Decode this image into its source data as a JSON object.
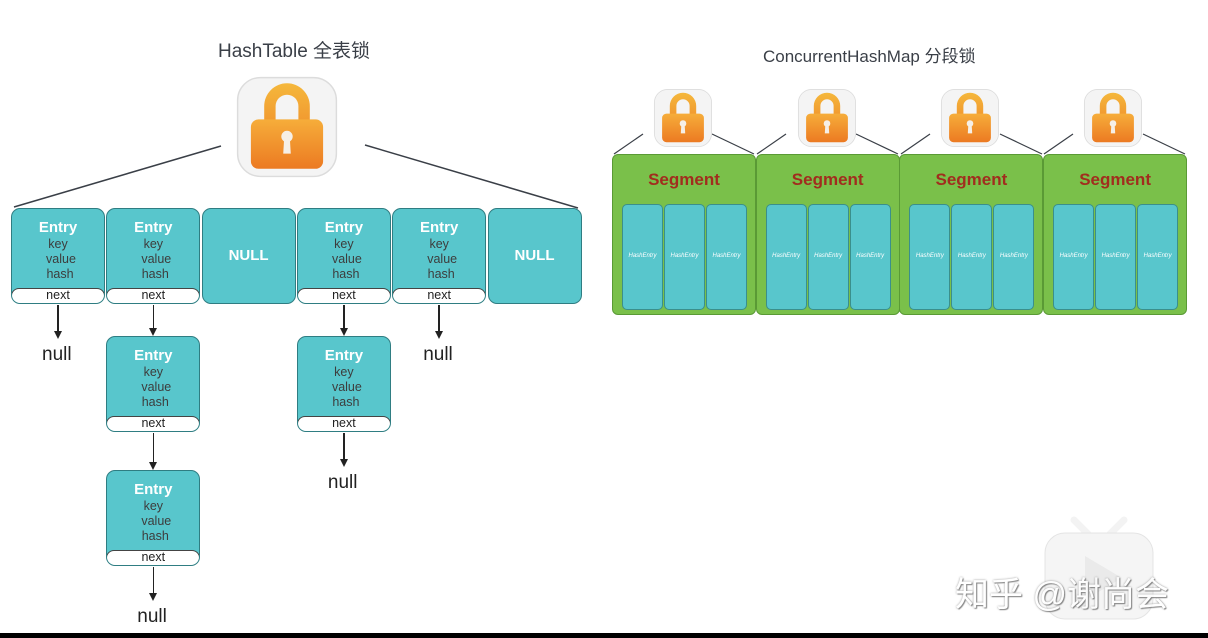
{
  "hashtable": {
    "title": "HashTable 全表锁",
    "lock_icon": "padlock-icon",
    "slots": [
      {
        "type": "entry",
        "name": "Entry",
        "fields": [
          "key",
          "value",
          "hash"
        ],
        "next": "next"
      },
      {
        "type": "entry",
        "name": "Entry",
        "fields": [
          "key",
          "value",
          "hash"
        ],
        "next": "next"
      },
      {
        "type": "null",
        "label": "NULL"
      },
      {
        "type": "entry",
        "name": "Entry",
        "fields": [
          "key",
          "value",
          "hash"
        ],
        "next": "next"
      },
      {
        "type": "entry",
        "name": "Entry",
        "fields": [
          "key",
          "value",
          "hash"
        ],
        "next": "next"
      },
      {
        "type": "null",
        "label": "NULL"
      }
    ],
    "chains": [
      {
        "slot": 0,
        "nodes": [],
        "terminal": "null"
      },
      {
        "slot": 1,
        "nodes": [
          {
            "name": "Entry",
            "fields": [
              "key",
              "value",
              "hash"
            ],
            "next": "next"
          },
          {
            "name": "Entry",
            "fields": [
              "key",
              "value",
              "hash"
            ],
            "next": "next"
          }
        ],
        "terminal": "null"
      },
      {
        "slot": 3,
        "nodes": [
          {
            "name": "Entry",
            "fields": [
              "key",
              "value",
              "hash"
            ],
            "next": "next"
          }
        ],
        "terminal": "null"
      },
      {
        "slot": 4,
        "nodes": [],
        "terminal": "null"
      }
    ]
  },
  "concurrenthashmap": {
    "title": "ConcurrentHashMap 分段锁",
    "lock_icon": "padlock-icon",
    "segments": [
      {
        "label": "Segment",
        "entries": [
          "HashEntry",
          "HashEntry",
          "HashEntry"
        ]
      },
      {
        "label": "Segment",
        "entries": [
          "HashEntry",
          "HashEntry",
          "HashEntry"
        ]
      },
      {
        "label": "Segment",
        "entries": [
          "HashEntry",
          "HashEntry",
          "HashEntry"
        ]
      },
      {
        "label": "Segment",
        "entries": [
          "HashEntry",
          "HashEntry",
          "HashEntry"
        ]
      }
    ]
  },
  "watermark": {
    "text": "知乎 @谢尚会",
    "icon": "tv-play-icon"
  },
  "colors": {
    "entry_fill": "#58c6cc",
    "segment_fill": "#7ac04a",
    "segment_label": "#a12d1e",
    "lock_orange": "#f0932b"
  }
}
